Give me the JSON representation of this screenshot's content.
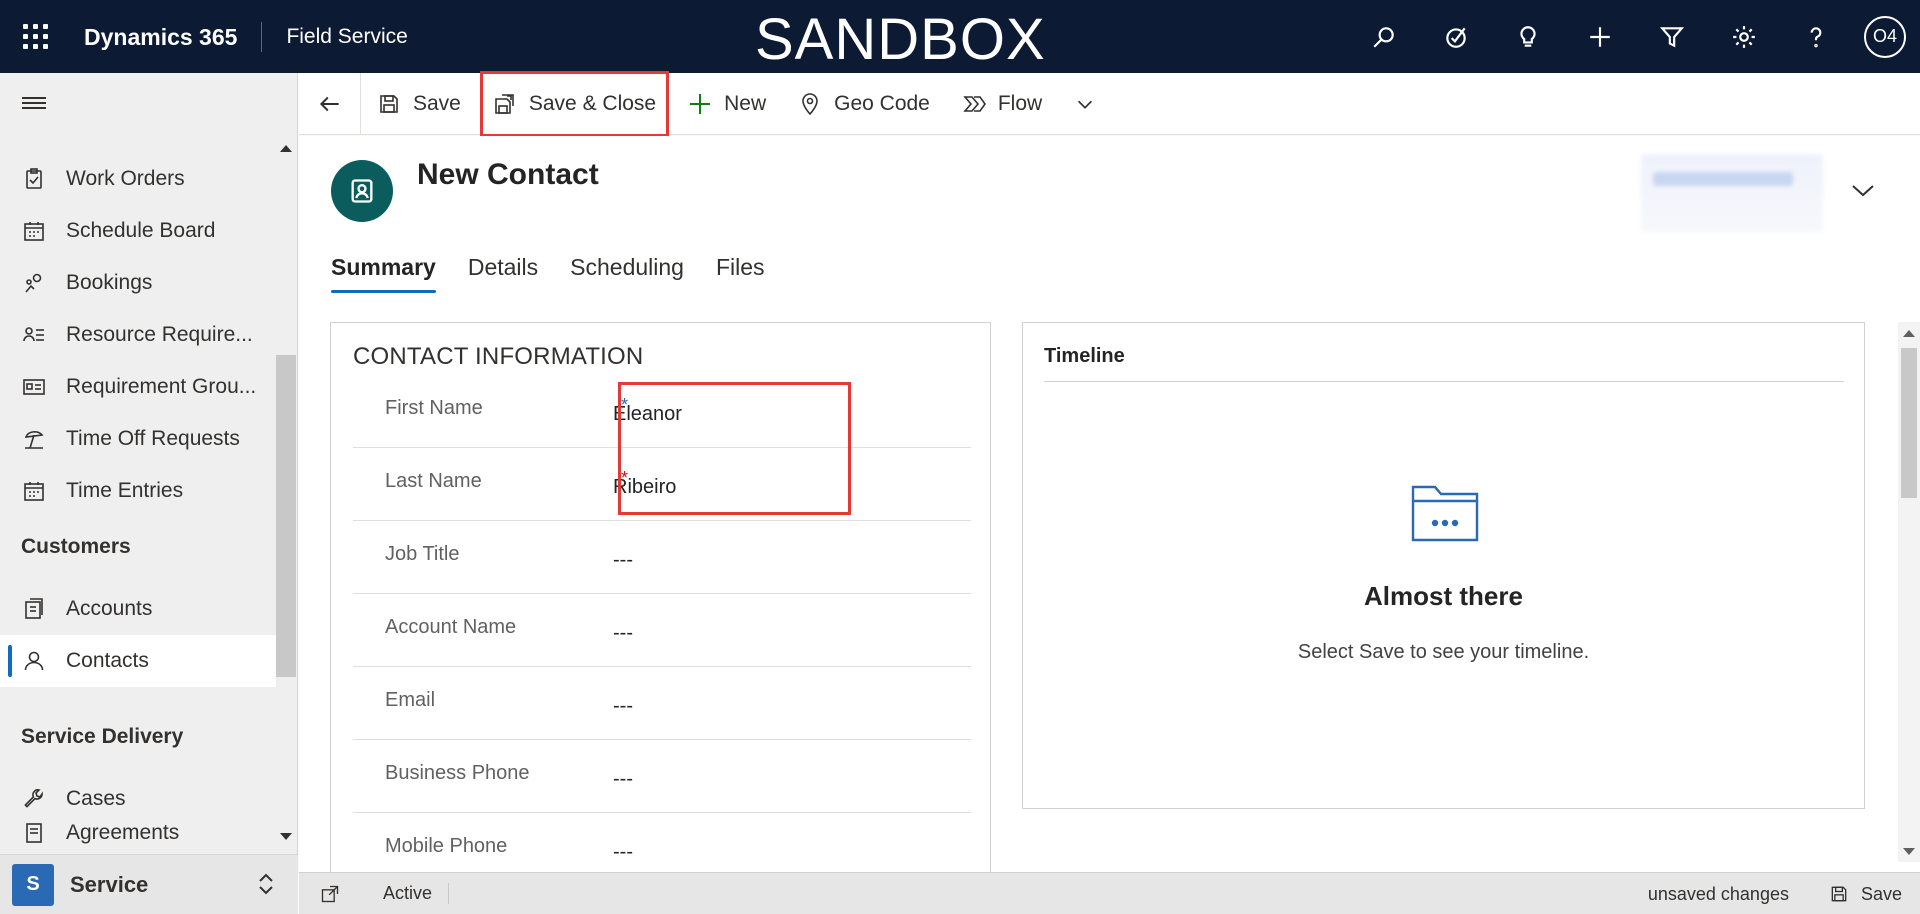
{
  "topbar": {
    "brand": "Dynamics 365",
    "app": "Field Service",
    "env_banner": "SANDBOX",
    "user_initials": "O4",
    "icons": [
      "search-icon",
      "task-icon",
      "lightbulb-icon",
      "plus-icon",
      "filter-icon",
      "gear-icon",
      "help-icon"
    ]
  },
  "sidebar": {
    "items": [
      {
        "label": "Work Orders",
        "icon": "clipboard-icon"
      },
      {
        "label": "Schedule Board",
        "icon": "calendar-icon"
      },
      {
        "label": "Bookings",
        "icon": "people-icon"
      },
      {
        "label": "Resource Require...",
        "icon": "list-person-icon"
      },
      {
        "label": "Requirement Grou...",
        "icon": "id-card-icon"
      },
      {
        "label": "Time Off Requests",
        "icon": "beach-icon"
      },
      {
        "label": "Time Entries",
        "icon": "calendar-icon"
      }
    ],
    "section_customers": "Customers",
    "customers": [
      {
        "label": "Accounts",
        "icon": "building-icon"
      },
      {
        "label": "Contacts",
        "icon": "person-icon",
        "active": true
      }
    ],
    "section_service": "Service Delivery",
    "service": [
      {
        "label": "Cases",
        "icon": "wrench-icon"
      },
      {
        "label": "Agreements",
        "icon": "document-icon"
      }
    ],
    "area": {
      "badge": "S",
      "label": "Service"
    }
  },
  "command_bar": {
    "save": "Save",
    "save_close": "Save & Close",
    "new": "New",
    "geo_code": "Geo Code",
    "flow": "Flow"
  },
  "record": {
    "title": "New Contact",
    "tabs": [
      "Summary",
      "Details",
      "Scheduling",
      "Files"
    ],
    "active_tab": "Summary"
  },
  "contact_info": {
    "section_title": "CONTACT INFORMATION",
    "fields": [
      {
        "label": "First Name",
        "value": "Eleanor",
        "required": "*",
        "required_color": "#2a6ab5"
      },
      {
        "label": "Last Name",
        "value": "Ribeiro",
        "required": "*",
        "required_color": "#c50f1f"
      },
      {
        "label": "Job Title",
        "value": "---"
      },
      {
        "label": "Account Name",
        "value": "---"
      },
      {
        "label": "Email",
        "value": "---"
      },
      {
        "label": "Business Phone",
        "value": "---"
      },
      {
        "label": "Mobile Phone",
        "value": "---"
      }
    ]
  },
  "timeline": {
    "title": "Timeline",
    "heading": "Almost there",
    "message": "Select Save to see your timeline."
  },
  "statusbar": {
    "status": "Active",
    "unsaved": "unsaved changes",
    "save": "Save"
  },
  "colors": {
    "topbar_bg": "#0c1a33",
    "accent": "#0f6cbd",
    "highlight": "#e53935",
    "record_icon_bg": "#0b5c5c"
  }
}
